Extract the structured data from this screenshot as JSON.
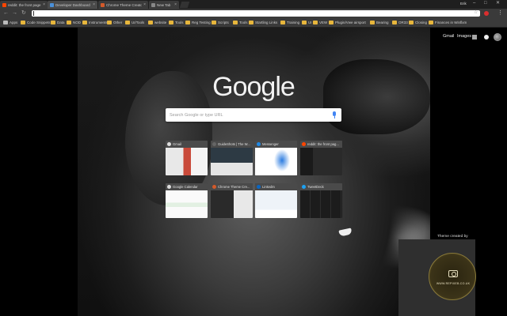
{
  "tabs": [
    {
      "title": "reddit: the front page o",
      "favicon_color": "#ff4500",
      "active": false
    },
    {
      "title": "Developer Dashboard",
      "favicon_color": "#4a90d9",
      "active": true
    },
    {
      "title": "Chrome Theme Creator",
      "favicon_color": "#d35a2a",
      "active": false
    },
    {
      "title": "New Tab",
      "favicon_color": "#888888",
      "active": false
    }
  ],
  "window": {
    "user": "Erik",
    "min": "–",
    "max": "□",
    "close": "✕"
  },
  "toolbar": {
    "back": "←",
    "forward": "→",
    "reload": "↻",
    "star": "☆",
    "menu": "⋮"
  },
  "bookmarks": [
    "Apps",
    "Code Snippets",
    "Data",
    "NOD",
    "Instruments",
    "Other",
    "UI/Tools",
    "website",
    "Tools",
    "Reg Testing",
    "Scripts",
    "Tools",
    "Startling Links",
    "Training",
    "UI",
    "VEW",
    "Plugin/Vwe airsport",
    "Bearing",
    "OR33",
    "Closing",
    "Finances in Winflxm"
  ],
  "google_header": {
    "gmail": "Gmail",
    "images": "Images"
  },
  "logo_text": "Google",
  "search": {
    "placeholder": "Search Google or type URL"
  },
  "tiles": [
    {
      "name": "Gmail",
      "icon_color": "#dddddd"
    },
    {
      "name": "GuideShots | The W...",
      "icon_color": "#666666"
    },
    {
      "name": "Messenger",
      "icon_color": "#1e88e5"
    },
    {
      "name": "reddit: the front pag...",
      "icon_color": "#ff4500"
    },
    {
      "name": "Google Calendar",
      "icon_color": "#dddddd"
    },
    {
      "name": "Chrome Theme Cre...",
      "icon_color": "#d35a2a"
    },
    {
      "name": "LinkedIn",
      "icon_color": "#0a66c2"
    },
    {
      "name": "TweetDeck",
      "icon_color": "#1da1f2"
    }
  ],
  "credits": {
    "label": "Theme created by",
    "site": "WWW.REPIXEB.CO.UK"
  }
}
